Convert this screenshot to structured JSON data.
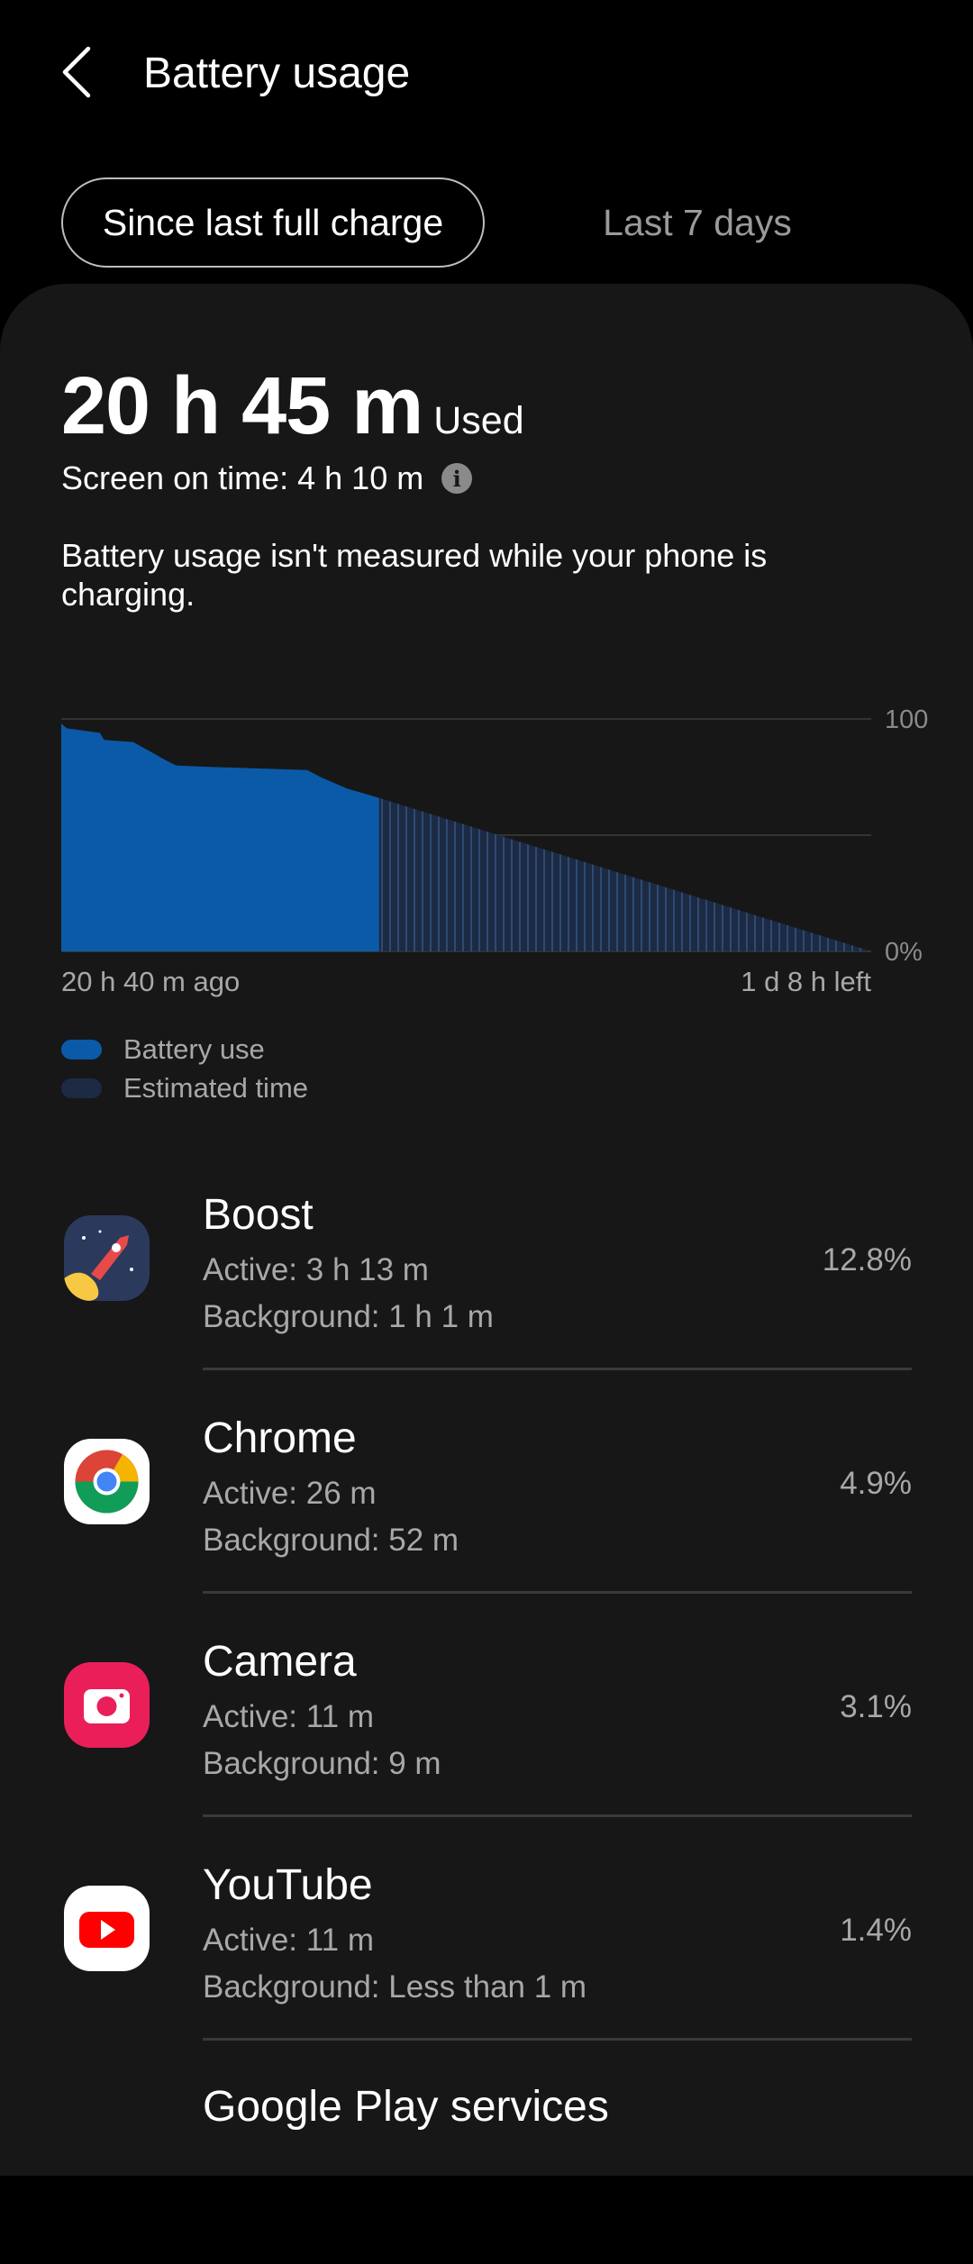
{
  "header": {
    "title": "Battery usage",
    "back_icon": "chevron-left-icon"
  },
  "tabs": [
    {
      "label": "Since last full charge",
      "selected": true
    },
    {
      "label": "Last 7 days",
      "selected": false
    }
  ],
  "summary": {
    "used_value": "20 h 45 m",
    "used_label": "Used",
    "screen_on_time": "Screen on time: 4 h 10 m",
    "info_icon": "info-icon",
    "note": "Battery usage isn't measured while your phone is charging."
  },
  "chart_data": {
    "type": "area",
    "y_tick_labels": [
      "100",
      "0%"
    ],
    "ylim": [
      0,
      100
    ],
    "x_labels": {
      "start": "20 h 40 m ago",
      "end": "1 d 8 h left"
    },
    "xlim_hours": [
      -20.67,
      32
    ],
    "grid": true,
    "legend_placement": "bottom-left",
    "series": [
      {
        "name": "Battery use",
        "color": "#0a5aa8",
        "points": [
          [
            -20.67,
            98
          ],
          [
            -20.32,
            96
          ],
          [
            -18.15,
            94
          ],
          [
            -17.89,
            91
          ],
          [
            -15.98,
            90
          ],
          [
            -13.8,
            82
          ],
          [
            -13.2,
            80
          ],
          [
            -11.6,
            79.5
          ],
          [
            -4.68,
            78
          ],
          [
            -3.81,
            75
          ],
          [
            -2.07,
            70
          ],
          [
            -0.5,
            67
          ],
          [
            0,
            66
          ]
        ]
      },
      {
        "name": "Estimated time",
        "color": "#1c2a44",
        "points": [
          [
            0,
            66
          ],
          [
            32,
            0
          ]
        ]
      }
    ]
  },
  "apps": [
    {
      "name": "Boost",
      "active": "Active: 3 h 13 m",
      "background": "Background: 1 h 1 m",
      "percent": "12.8%",
      "icon": "rocket-icon"
    },
    {
      "name": "Chrome",
      "active": "Active: 26 m",
      "background": "Background: 52 m",
      "percent": "4.9%",
      "icon": "chrome-icon"
    },
    {
      "name": "Camera",
      "active": "Active: 11 m",
      "background": "Background: 9 m",
      "percent": "3.1%",
      "icon": "camera-icon"
    },
    {
      "name": "YouTube",
      "active": "Active: 11 m",
      "background": "Background: Less than 1 m",
      "percent": "1.4%",
      "icon": "youtube-icon"
    },
    {
      "name": "Google Play services"
    }
  ]
}
